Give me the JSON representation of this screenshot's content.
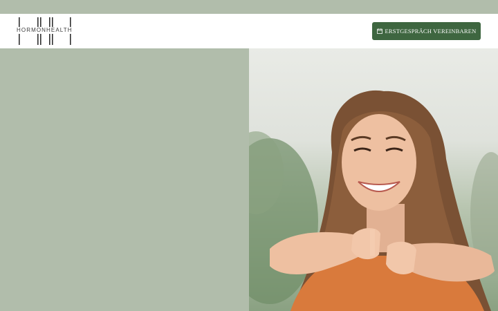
{
  "brand": {
    "name": "HORMONHEALTH"
  },
  "header": {
    "cta_label": "ERSTGESPRÄCH VEREINBAREN",
    "cta_icon": "calendar-icon"
  },
  "hero": {
    "image": "smiling-woman-pointing-photo"
  },
  "colors": {
    "sage": "#b1bdab",
    "cta_green": "#3e6640",
    "header_bg": "#ffffff"
  }
}
